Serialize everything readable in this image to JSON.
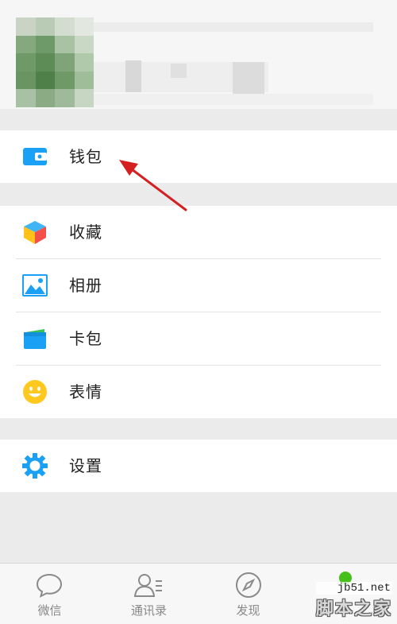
{
  "menu": {
    "wallet_label": "钱包",
    "favorites_label": "收藏",
    "album_label": "相册",
    "cards_label": "卡包",
    "stickers_label": "表情",
    "settings_label": "设置"
  },
  "tabbar": {
    "chats_label": "微信",
    "contacts_label": "通讯录",
    "discover_label": "发现"
  },
  "watermark": {
    "url": "jb51.net",
    "name": "脚本之家"
  },
  "icons": {
    "wallet": "wallet-icon",
    "favorites": "cube-icon",
    "album": "picture-icon",
    "cards": "card-pack-icon",
    "stickers": "smiley-icon",
    "settings": "gear-icon",
    "chats": "chat-bubble-icon",
    "contacts": "contacts-icon",
    "discover": "compass-icon",
    "me": "person-icon"
  },
  "colors": {
    "accent_blue": "#1aa1f5",
    "annotation_red": "#d42020",
    "background": "#ebebeb"
  }
}
